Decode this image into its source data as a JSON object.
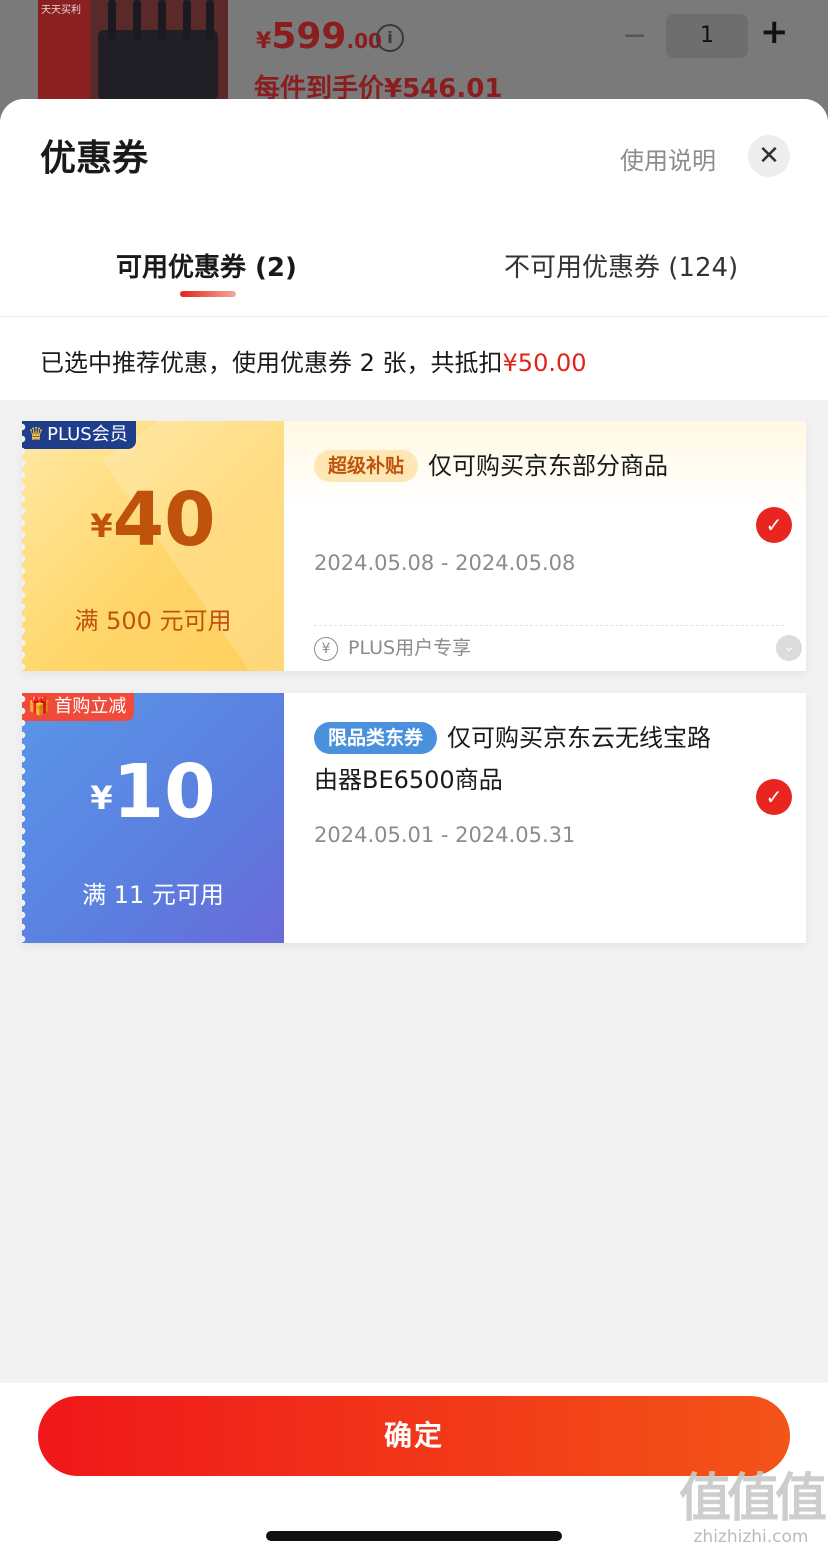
{
  "background_product": {
    "thumb_banner": "天天买利",
    "price_symbol": "¥",
    "price_int": "599",
    "price_dec": ".00",
    "info_icon": "info-icon",
    "final_price": "每件到手价¥546.01",
    "quantity": "1",
    "minus_symbol": "−",
    "plus_symbol": "+"
  },
  "sheet": {
    "title": "优惠券",
    "help_link": "使用说明",
    "close_symbol": "✕",
    "tabs": [
      {
        "label": "可用优惠券 (2)",
        "active": true
      },
      {
        "label": "不可用优惠券 (124)",
        "active": false
      }
    ],
    "summary_text": "已选中推荐优惠，使用优惠券 2 张，共抵扣",
    "summary_amount": "¥50.00"
  },
  "coupons": [
    {
      "badge": "PLUS会员",
      "badge_icon": "crown-icon",
      "currency": "¥",
      "amount": "40",
      "condition": "满 500 元可用",
      "tag": "超级补贴",
      "description": "仅可购买京东部分商品",
      "date_range": "2024.05.08 - 2024.05.08",
      "footer": "PLUS用户专享",
      "footer_icon": "yen-circle-icon",
      "selected": true
    },
    {
      "badge": "首购立减",
      "badge_icon": "gift-icon",
      "currency": "¥",
      "amount": "10",
      "condition": "满 11 元可用",
      "tag": "限品类东券",
      "description": "仅可购买京东云无线宝路由器BE6500商品",
      "date_range": "2024.05.01 - 2024.05.31",
      "selected": true
    }
  ],
  "confirm_button": "确定",
  "watermark": {
    "text": "值值值",
    "url": "zhizhizhi.com"
  },
  "colors": {
    "accent": "#e2231a",
    "plus_gold": "#ffd66a",
    "coupon_blue": "#5b7fe0"
  }
}
